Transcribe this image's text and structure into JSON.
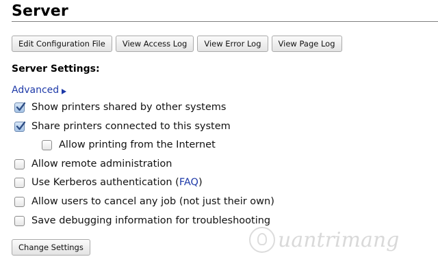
{
  "header": {
    "title": "Server"
  },
  "toolbar": {
    "edit_config": "Edit Configuration File",
    "access_log": "View Access Log",
    "error_log": "View Error Log",
    "page_log": "View Page Log"
  },
  "settings": {
    "heading": "Server Settings:",
    "advanced": "Advanced",
    "options": {
      "show_shared": {
        "label": "Show printers shared by other systems",
        "checked": true
      },
      "share_connected": {
        "label": "Share printers connected to this system",
        "checked": true
      },
      "allow_internet": {
        "label": "Allow printing from the Internet",
        "checked": false
      },
      "remote_admin": {
        "label": "Allow remote administration",
        "checked": false
      },
      "kerberos": {
        "label_before": "Use Kerberos authentication (",
        "link": "FAQ",
        "label_after": ")",
        "checked": false
      },
      "cancel_any": {
        "label": "Allow users to cancel any job (not just their own)",
        "checked": false
      },
      "debug": {
        "label": "Save debugging information for troubleshooting",
        "checked": false
      }
    },
    "change_button": "Change Settings"
  },
  "watermark": {
    "text": "uantrimang"
  },
  "colors": {
    "link": "#1d39a8",
    "check_fill": "#a7c4e6",
    "check_mark": "#2f4f86"
  }
}
